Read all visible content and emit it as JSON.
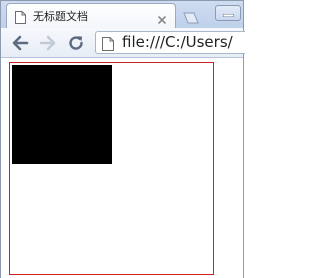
{
  "browser": {
    "tab": {
      "title": "无标题文档"
    },
    "toolbar": {
      "address": "file:///C:/Users/"
    }
  },
  "icons": {
    "favicon": "page-icon",
    "close": "close-icon",
    "new_tab": "new-tab-icon",
    "minimize": "minimize-icon",
    "back": "back-arrow-icon",
    "forward": "forward-arrow-icon",
    "reload": "reload-icon",
    "address_page": "page-icon"
  },
  "colors": {
    "box_border": "#cc2222",
    "square_fill": "#000000"
  }
}
